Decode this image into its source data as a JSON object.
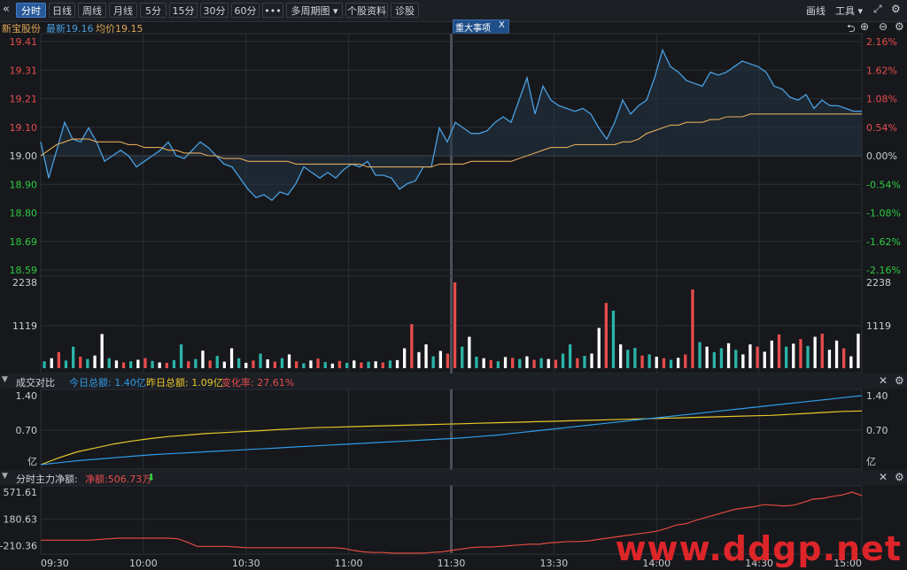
{
  "toolbar": {
    "back_icon": "«",
    "tabs": [
      {
        "label": "分时",
        "active": true
      },
      {
        "label": "日线"
      },
      {
        "label": "周线"
      },
      {
        "label": "月线"
      },
      {
        "label": "5分"
      },
      {
        "label": "15分"
      },
      {
        "label": "30分"
      },
      {
        "label": "60分"
      },
      {
        "label": "•••"
      },
      {
        "label": "多周期图 ▾"
      },
      {
        "label": "个股资料"
      },
      {
        "label": "诊股"
      }
    ],
    "draw_label": "画线",
    "tools_label": "工具 ▾",
    "expand_icon": "⤢",
    "settings_icon": "gear-icon"
  },
  "info": {
    "stock_name": "新宝股份",
    "latest": "最新19.16",
    "avg": "均价19.15",
    "event_tag": "重大事项",
    "event_close": "X"
  },
  "panel_icons": {
    "back": "⮌",
    "plus": "⊕",
    "minus": "⊖",
    "gear": "⚙"
  },
  "colors": {
    "up": "#e74c4c",
    "down": "#2ecc40",
    "price_line": "#4a9fe0",
    "avg_line": "#e0a85a",
    "today": "#2f9be6",
    "yesterday": "#e8c82a",
    "net": "#e04a3f"
  },
  "chart_data": [
    {
      "type": "line",
      "name": "price",
      "y_ticks_left": [
        "19.41",
        "19.31",
        "19.21",
        "19.10",
        "19.00",
        "18.90",
        "18.80",
        "18.69",
        "18.59"
      ],
      "y_ticks_right": [
        "2.16%",
        "1.62%",
        "1.08%",
        "0.54%",
        "0.00%",
        "-0.54%",
        "-1.08%",
        "-1.62%",
        "-2.16%"
      ],
      "ylim": [
        18.59,
        19.41
      ],
      "prev_close": 19.0,
      "x_ticks": [
        "09:30",
        "10:00",
        "10:30",
        "11:00",
        "11:30",
        "13:30",
        "14:00",
        "14:30",
        "15:00"
      ],
      "series": [
        {
          "name": "最新",
          "values": [
            19.05,
            18.92,
            19.02,
            19.12,
            19.06,
            19.05,
            19.1,
            19.05,
            18.98,
            19.0,
            19.02,
            19.0,
            18.96,
            18.98,
            19.0,
            19.02,
            19.05,
            19.0,
            18.99,
            19.02,
            19.05,
            19.03,
            19.0,
            18.97,
            18.96,
            18.92,
            18.88,
            18.85,
            18.86,
            18.84,
            18.87,
            18.86,
            18.9,
            18.96,
            18.94,
            18.92,
            18.94,
            18.92,
            18.95,
            18.97,
            18.96,
            18.98,
            18.93,
            18.93,
            18.92,
            18.88,
            18.9,
            18.91,
            18.96,
            18.96,
            19.1,
            19.05,
            19.12,
            19.1,
            19.08,
            19.08,
            19.09,
            19.12,
            19.14,
            19.12,
            19.2,
            19.28,
            19.15,
            19.25,
            19.2,
            19.18,
            19.17,
            19.16,
            19.17,
            19.15,
            19.1,
            19.06,
            19.12,
            19.2,
            19.15,
            19.18,
            19.2,
            19.28,
            19.38,
            19.32,
            19.3,
            19.27,
            19.26,
            19.25,
            19.3,
            19.29,
            19.3,
            19.32,
            19.34,
            19.33,
            19.32,
            19.3,
            19.25,
            19.24,
            19.21,
            19.2,
            19.22,
            19.17,
            19.2,
            19.18,
            19.18,
            19.17,
            19.16,
            19.16
          ]
        },
        {
          "name": "均价",
          "values": [
            19.0,
            19.02,
            19.04,
            19.05,
            19.06,
            19.06,
            19.06,
            19.05,
            19.05,
            19.05,
            19.05,
            19.04,
            19.04,
            19.03,
            19.03,
            19.03,
            19.02,
            19.02,
            19.01,
            19.01,
            19.01,
            19.0,
            19.0,
            18.99,
            18.99,
            18.99,
            18.98,
            18.98,
            18.98,
            18.98,
            18.98,
            18.98,
            18.97,
            18.97,
            18.97,
            18.97,
            18.97,
            18.97,
            18.97,
            18.97,
            18.97,
            18.96,
            18.96,
            18.96,
            18.96,
            18.96,
            18.96,
            18.96,
            18.96,
            18.96,
            18.97,
            18.97,
            18.97,
            18.97,
            18.98,
            18.98,
            18.98,
            18.98,
            18.98,
            18.98,
            18.99,
            19.0,
            19.01,
            19.02,
            19.03,
            19.03,
            19.03,
            19.04,
            19.04,
            19.04,
            19.04,
            19.04,
            19.04,
            19.05,
            19.05,
            19.06,
            19.08,
            19.09,
            19.1,
            19.11,
            19.11,
            19.12,
            19.12,
            19.12,
            19.13,
            19.13,
            19.14,
            19.14,
            19.14,
            19.15,
            19.15,
            19.15,
            19.15,
            19.15,
            19.15,
            19.15,
            19.15,
            19.15,
            19.15,
            19.15,
            19.15,
            19.15,
            19.15,
            19.15
          ]
        }
      ]
    },
    {
      "type": "bar",
      "name": "volume",
      "y_ticks": [
        "2238",
        "1119"
      ],
      "ylim": [
        0,
        2238
      ],
      "values": [
        180,
        260,
        420,
        200,
        560,
        300,
        240,
        330,
        890,
        260,
        200,
        150,
        180,
        220,
        260,
        190,
        150,
        140,
        210,
        620,
        180,
        240,
        460,
        200,
        320,
        170,
        520,
        260,
        140,
        200,
        380,
        230,
        170,
        260,
        360,
        180,
        130,
        200,
        250,
        160,
        120,
        190,
        140,
        200,
        150,
        170,
        180,
        150,
        200,
        210,
        520,
        1150,
        420,
        620,
        310,
        450,
        380,
        2238,
        560,
        820,
        300,
        260,
        210,
        180,
        290,
        270,
        240,
        310,
        220,
        260,
        240,
        220,
        380,
        620,
        260,
        320,
        380,
        1050,
        1700,
        1500,
        620,
        480,
        530,
        330,
        360,
        300,
        260,
        220,
        270,
        360,
        2050,
        680,
        560,
        420,
        520,
        650,
        480,
        360,
        620,
        560,
        430,
        720,
        880,
        560,
        640,
        760,
        580,
        820,
        900,
        480,
        720,
        520,
        310,
        900
      ]
    },
    {
      "type": "line",
      "name": "成交对比",
      "header": {
        "title": "成交对比",
        "today": "今日总额: 1.40亿",
        "yesterday": "昨日总额: 1.09亿",
        "change": "变化率: 27.61%"
      },
      "y_ticks": [
        "1.40",
        "0.70",
        "亿"
      ],
      "ylim": [
        0,
        1.4
      ],
      "series": [
        {
          "name": "今日总额",
          "values": [
            0.0,
            0.04,
            0.08,
            0.11,
            0.14,
            0.17,
            0.2,
            0.22,
            0.24,
            0.26,
            0.28,
            0.3,
            0.32,
            0.34,
            0.36,
            0.38,
            0.4,
            0.42,
            0.44,
            0.46,
            0.48,
            0.5,
            0.52,
            0.54,
            0.57,
            0.6,
            0.64,
            0.68,
            0.72,
            0.76,
            0.8,
            0.84,
            0.88,
            0.92,
            0.96,
            1.0,
            1.04,
            1.08,
            1.12,
            1.16,
            1.2,
            1.24,
            1.28,
            1.32,
            1.36,
            1.4
          ]
        },
        {
          "name": "昨日总额",
          "values": [
            0.0,
            0.14,
            0.26,
            0.34,
            0.42,
            0.48,
            0.53,
            0.57,
            0.6,
            0.63,
            0.65,
            0.67,
            0.69,
            0.71,
            0.73,
            0.75,
            0.76,
            0.77,
            0.78,
            0.79,
            0.8,
            0.81,
            0.82,
            0.83,
            0.84,
            0.85,
            0.86,
            0.87,
            0.88,
            0.89,
            0.9,
            0.91,
            0.92,
            0.93,
            0.94,
            0.95,
            0.96,
            0.97,
            0.98,
            0.99,
            1.0,
            1.02,
            1.04,
            1.06,
            1.08,
            1.09
          ]
        }
      ]
    },
    {
      "type": "line",
      "name": "分时主力净额",
      "header": {
        "title": "分时主力净额:",
        "net": "净额:506.73万",
        "arrow": "⬇"
      },
      "y_ticks": [
        "571.61",
        "180.63",
        "-210.36"
      ],
      "ylim": [
        -320,
        571.61
      ],
      "values": [
        -130,
        -130,
        -130,
        -130,
        -130,
        -130,
        -120,
        -110,
        -100,
        -100,
        -100,
        -100,
        -100,
        -100,
        -110,
        -160,
        -220,
        -220,
        -220,
        -220,
        -230,
        -240,
        -240,
        -240,
        -240,
        -240,
        -240,
        -240,
        -240,
        -240,
        -240,
        -250,
        -280,
        -300,
        -310,
        -310,
        -320,
        -320,
        -320,
        -320,
        -310,
        -300,
        -280,
        -260,
        -240,
        -230,
        -230,
        -220,
        -210,
        -200,
        -190,
        -190,
        -170,
        -160,
        -150,
        -150,
        -140,
        -120,
        -100,
        -80,
        -60,
        -40,
        -20,
        0,
        40,
        90,
        110,
        160,
        200,
        240,
        280,
        320,
        340,
        360,
        390,
        380,
        370,
        380,
        420,
        470,
        480,
        510,
        530,
        571,
        520
      ]
    }
  ]
}
